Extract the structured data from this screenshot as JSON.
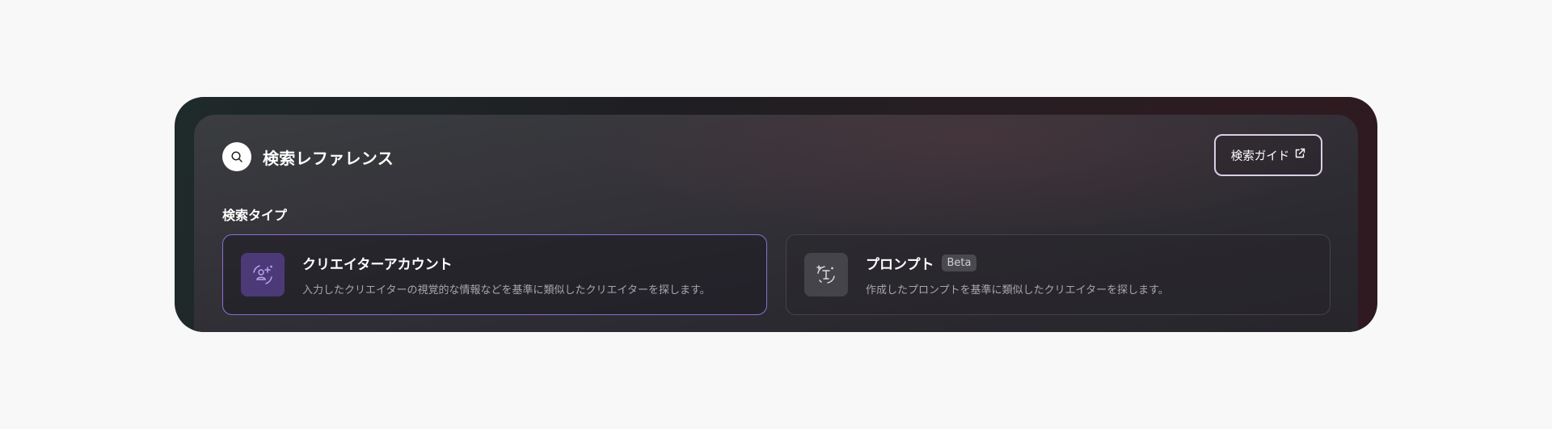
{
  "header": {
    "title": "検索レファレンス",
    "icon": "search-icon"
  },
  "guide_button": {
    "label": "検索ガイド",
    "icon": "external-link-icon"
  },
  "search_type": {
    "label": "検索タイプ",
    "options": [
      {
        "title": "クリエイターアカウント",
        "description": "入力したクリエイターの視覚的な情報などを基準に類似したクリエイターを探します。",
        "icon": "creator-account-icon",
        "selected": true
      },
      {
        "title": "プロンプト",
        "badge": "Beta",
        "description": "作成したプロンプトを基準に類似したクリエイターを探します。",
        "icon": "prompt-text-icon",
        "selected": false
      }
    ]
  },
  "colors": {
    "accent": "#8a6fd6",
    "selected_icon_bg": "#4c3a78",
    "panel_dark": "#26252a"
  }
}
